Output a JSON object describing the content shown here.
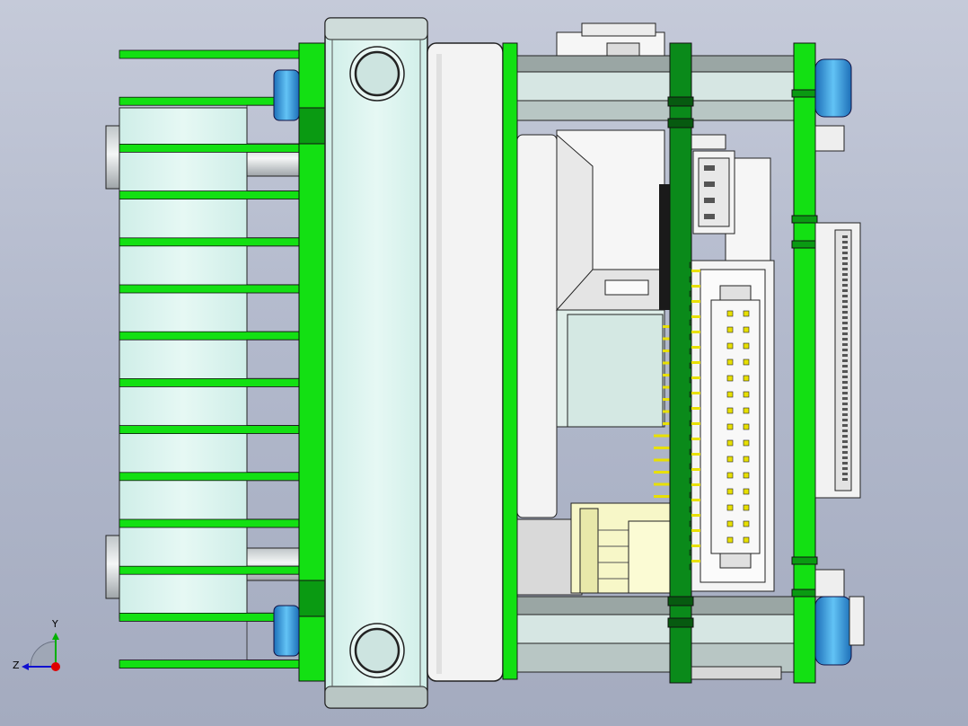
{
  "viewport": {
    "background_top": "#c5cad9",
    "background_bottom": "#a4abbf"
  },
  "model": {
    "view": "side",
    "colors": {
      "pcb_green": "#13e013",
      "pcb_dark": "#0a7a12",
      "body_mint": "#d9f3ef",
      "body_gray": "#d4dbd9",
      "connector_white": "#f4f4f4",
      "connector_yellow": "#f7f7c8",
      "nut_blue": "#3aa8e8",
      "outline": "#1a1a1a",
      "pin_gold": "#e8e000"
    },
    "header_pin_rows": 15,
    "header_pin_cols": 2,
    "heatsink_fins": 14
  },
  "triad": {
    "y_label": "Y",
    "z_label": "Z",
    "y_color": "#00b000",
    "z_color": "#1010d0",
    "origin_color": "#e00000",
    "icon": "coordinate-triad-icon"
  }
}
